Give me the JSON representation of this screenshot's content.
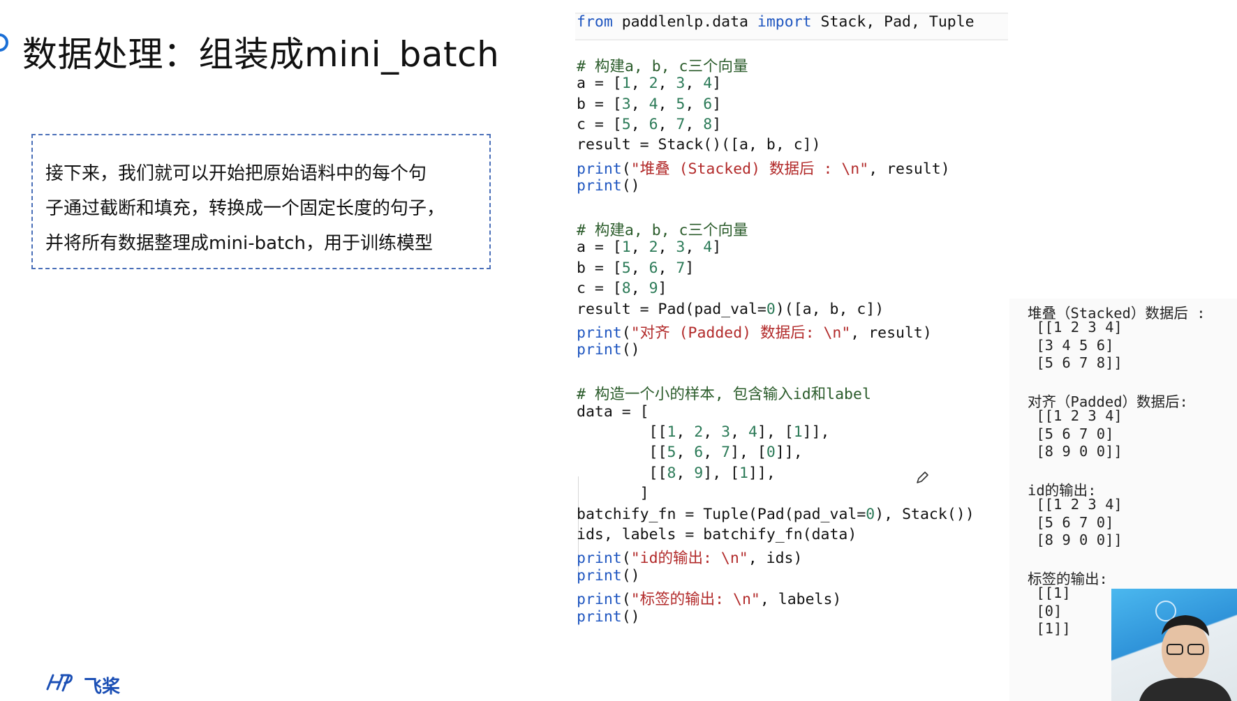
{
  "slide": {
    "title": "数据处理：组装成mini_batch",
    "description": [
      "接下来，我们就可以开始把原始语料中的每个句",
      "子通过截断和填充，转换成一个固定长度的句子，",
      "并将所有数据整理成mini-batch，用于训练模型"
    ],
    "logo_text": "飞桨"
  },
  "code": {
    "lines": [
      "from paddlenlp.data import Stack, Pad, Tuple",
      "",
      "# 构建a, b, c三个向量",
      "a = [1, 2, 3, 4]",
      "b = [3, 4, 5, 6]",
      "c = [5, 6, 7, 8]",
      "result = Stack()([a, b, c])",
      "print(\"堆叠 (Stacked) 数据后 : \\n\", result)",
      "print()",
      "",
      "# 构建a, b, c三个向量",
      "a = [1, 2, 3, 4]",
      "b = [5, 6, 7]",
      "c = [8, 9]",
      "result = Pad(pad_val=0)([a, b, c])",
      "print(\"对齐 (Padded) 数据后: \\n\", result)",
      "print()",
      "",
      "# 构造一个小的样本, 包含输入id和label",
      "data = [",
      "        [[1, 2, 3, 4], [1]],",
      "        [[5, 6, 7], [0]],",
      "        [[8, 9], [1]],",
      "       ]",
      "batchify_fn = Tuple(Pad(pad_val=0), Stack())",
      "ids, labels = batchify_fn(data)",
      "print(\"id的输出: \\n\", ids)",
      "print()",
      "print(\"标签的输出: \\n\", labels)",
      "print()"
    ]
  },
  "output": {
    "lines": [
      "堆叠（Stacked）数据后 :",
      " [[1 2 3 4]",
      " [3 4 5 6]",
      " [5 6 7 8]]",
      "",
      "对齐（Padded）数据后:",
      " [[1 2 3 4]",
      " [5 6 7 0]",
      " [8 9 0 0]]",
      "",
      "id的输出:",
      " [[1 2 3 4]",
      " [5 6 7 0]",
      " [8 9 0 0]]",
      "",
      "标签的输出:",
      " [[1]",
      " [0]",
      " [1]]"
    ]
  },
  "icons": {
    "pen": "pencil-cursor-icon",
    "logo": "paddle-logo-icon"
  },
  "colors": {
    "accent": "#1b6fd6",
    "keyword": "#1f56c0",
    "number": "#2b7a57",
    "string": "#b22a2a",
    "comment": "#2a5b2a"
  }
}
